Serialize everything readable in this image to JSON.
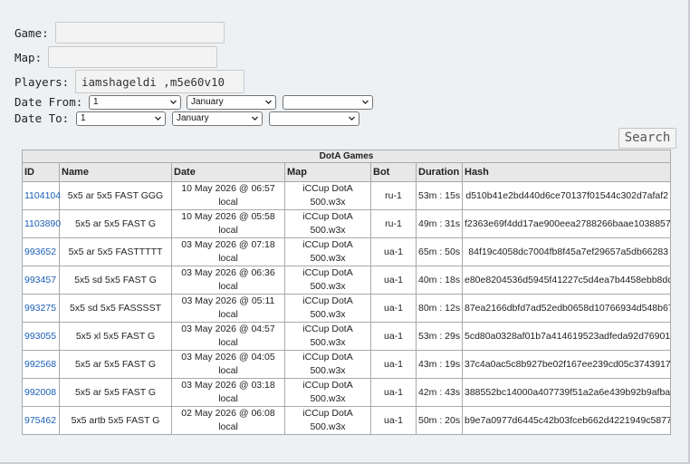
{
  "form": {
    "game_label": "Game:",
    "map_label": "Map:",
    "players_label": "Players:",
    "players_value": "iamshageldi ,m5e60v10",
    "date_from_label": "Date From:",
    "date_to_label": "Date To:",
    "from_day": "1",
    "from_month": "January",
    "from_year": "",
    "to_day": "1",
    "to_month": "January",
    "to_year": "",
    "search_label": "Search"
  },
  "table": {
    "title": "DotA Games",
    "columns": [
      "ID",
      "Name",
      "Date",
      "Map",
      "Bot",
      "Duration",
      "Hash"
    ],
    "rows": [
      {
        "id": "1104104",
        "name": "5x5 ar 5x5 FAST GGG",
        "date": "10 May 2026 @ 06:57",
        "tz": "local",
        "map": "iCCup DotA",
        "map2": "500.w3x",
        "bot": "ru-1",
        "duration": "53m : 15s",
        "hash": "d510b41e2bd440d6ce70137f01544c302d7afaf2"
      },
      {
        "id": "1103890",
        "name": "5x5 ar 5x5 FAST G",
        "date": "10 May 2026 @ 05:58",
        "tz": "local",
        "map": "iCCup DotA",
        "map2": "500.w3x",
        "bot": "ru-1",
        "duration": "49m : 31s",
        "hash": "f2363e69f4dd17ae900eea2788266baae1038857"
      },
      {
        "id": "993652",
        "name": "5x5 ar 5x5 FASTTTTT",
        "date": "03 May 2026 @ 07:18",
        "tz": "local",
        "map": "iCCup DotA",
        "map2": "500.w3x",
        "bot": "ua-1",
        "duration": "65m : 50s",
        "hash": "84f19c4058dc7004fb8f45a7ef29657a5db66283"
      },
      {
        "id": "993457",
        "name": "5x5 sd 5x5 FAST G",
        "date": "03 May 2026 @ 06:36",
        "tz": "local",
        "map": "iCCup DotA",
        "map2": "500.w3x",
        "bot": "ua-1",
        "duration": "40m : 18s",
        "hash": "e80e8204536d5945f41227c5d4ea7b4458ebb8dc"
      },
      {
        "id": "993275",
        "name": "5x5 sd 5x5 FASSSST",
        "date": "03 May 2026 @ 05:11",
        "tz": "local",
        "map": "iCCup DotA",
        "map2": "500.w3x",
        "bot": "ua-1",
        "duration": "80m : 12s",
        "hash": "87ea2166dbfd7ad52edb0658d10766934d548b67"
      },
      {
        "id": "993055",
        "name": "5x5 xl 5x5 FAST G",
        "date": "03 May 2026 @ 04:57",
        "tz": "local",
        "map": "iCCup DotA",
        "map2": "500.w3x",
        "bot": "ua-1",
        "duration": "53m : 29s",
        "hash": "5cd80a0328af01b7a414619523adfeda92d76901"
      },
      {
        "id": "992568",
        "name": "5x5 ar 5x5 FAST G",
        "date": "03 May 2026 @ 04:05",
        "tz": "local",
        "map": "iCCup DotA",
        "map2": "500.w3x",
        "bot": "ua-1",
        "duration": "43m : 19s",
        "hash": "37c4a0ac5c8b927be02f167ee239cd05c3743917"
      },
      {
        "id": "992008",
        "name": "5x5 ar 5x5 FAST G",
        "date": "03 May 2026 @ 03:18",
        "tz": "local",
        "map": "iCCup DotA",
        "map2": "500.w3x",
        "bot": "ua-1",
        "duration": "42m : 43s",
        "hash": "388552bc14000a407739f51a2a6e439b92b9afba"
      },
      {
        "id": "975462",
        "name": "5x5 artb 5x5 FAST G",
        "date": "02 May 2026 @ 06:08",
        "tz": "local",
        "map": "iCCup DotA",
        "map2": "500.w3x",
        "bot": "ua-1",
        "duration": "50m : 20s",
        "hash": "b9e7a0977d6445c42b03fceb662d4221949c5877"
      }
    ]
  }
}
